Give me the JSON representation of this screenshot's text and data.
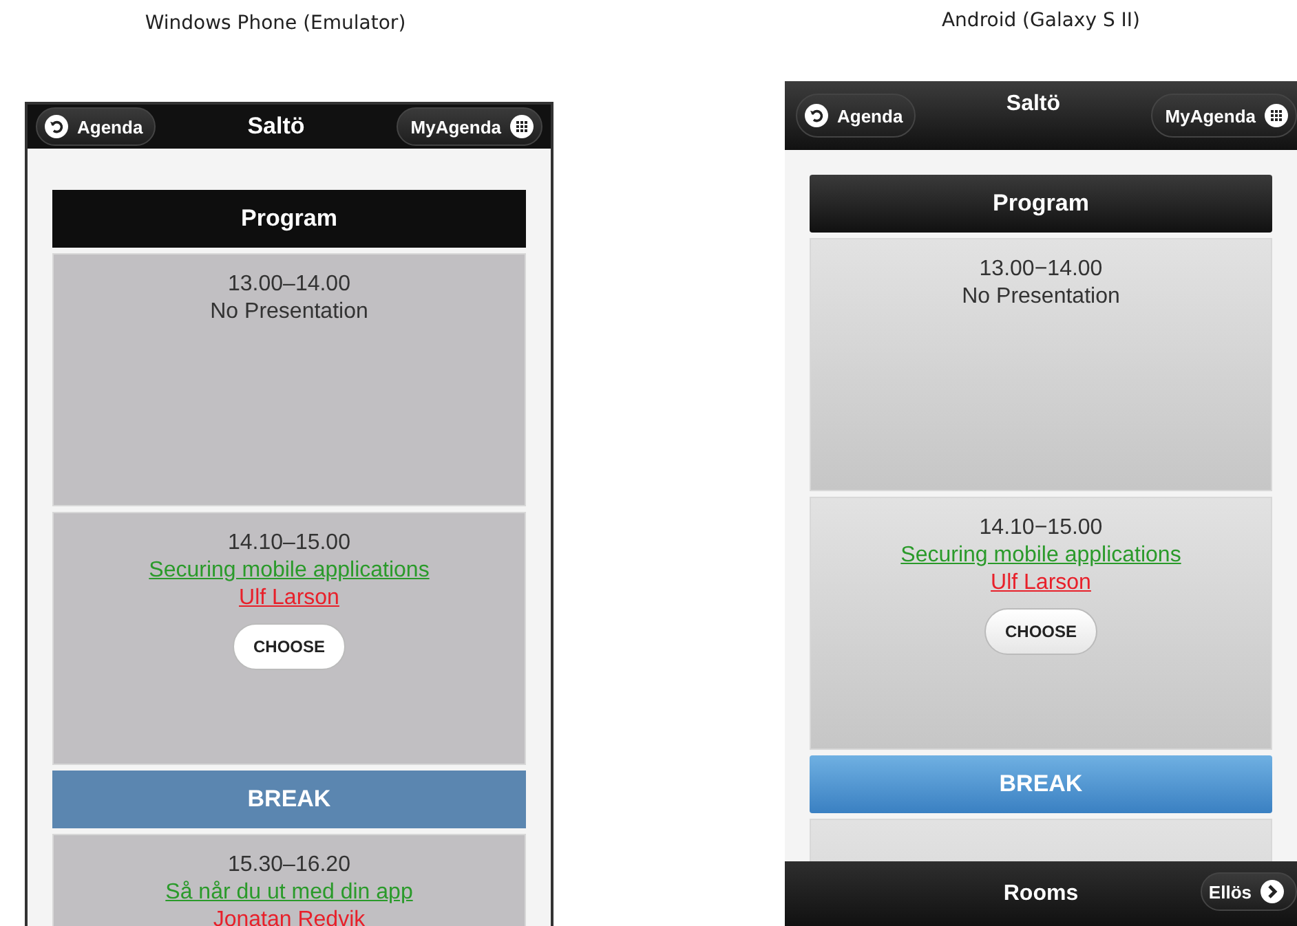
{
  "panels": [
    {
      "caption": "Windows Phone (Emulator)",
      "kind": "windows",
      "header": {
        "back": "Agenda",
        "title": "Saltö",
        "menu": "MyAgenda"
      },
      "program_title": "Program",
      "blocks": [
        {
          "kind": "session",
          "time": "13.00–14.00",
          "note": "No Presentation"
        },
        {
          "kind": "session",
          "time": "14.10–15.00",
          "title": "Securing mobile applications",
          "speaker": "Ulf Larson",
          "action": "CHOOSE"
        },
        {
          "kind": "break",
          "label": "BREAK"
        },
        {
          "kind": "session",
          "time": "15.30–16.20",
          "title": "Så når du ut med din app",
          "speaker": "Jonatan Redvik"
        }
      ]
    },
    {
      "caption": "Android (Galaxy S II)",
      "kind": "android",
      "header": {
        "back": "Agenda",
        "title": "Saltö",
        "menu": "MyAgenda"
      },
      "program_title": "Program",
      "blocks": [
        {
          "kind": "session",
          "time": "13.00−14.00",
          "note": "No Presentation"
        },
        {
          "kind": "session",
          "time": "14.10−15.00",
          "title": "Securing mobile applications",
          "speaker": "Ulf Larson",
          "action": "CHOOSE"
        },
        {
          "kind": "break",
          "label": "BREAK"
        },
        {
          "kind": "session"
        }
      ],
      "footer": {
        "title": "Rooms",
        "next": "Ellös"
      }
    }
  ]
}
